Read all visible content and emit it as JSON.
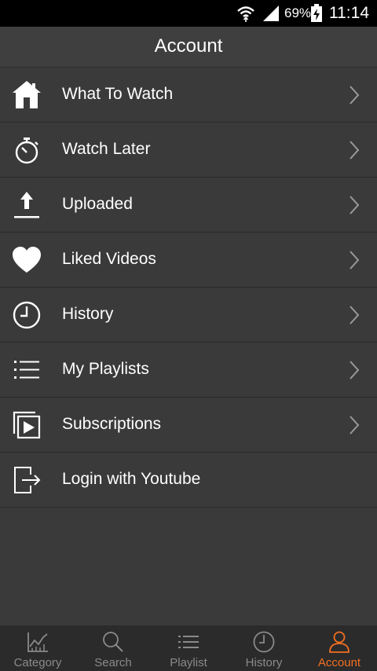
{
  "status_bar": {
    "battery_percent": "69%",
    "time": "11:14"
  },
  "header": {
    "title": "Account"
  },
  "menu": {
    "items": [
      {
        "label": "What To Watch",
        "icon": "home-icon"
      },
      {
        "label": "Watch Later",
        "icon": "stopwatch-icon"
      },
      {
        "label": "Uploaded",
        "icon": "upload-icon"
      },
      {
        "label": "Liked Videos",
        "icon": "heart-icon"
      },
      {
        "label": "History",
        "icon": "clock-icon"
      },
      {
        "label": "My Playlists",
        "icon": "list-icon"
      },
      {
        "label": "Subscriptions",
        "icon": "subscriptions-icon"
      },
      {
        "label": "Login with Youtube",
        "icon": "login-icon"
      }
    ]
  },
  "bottom_nav": {
    "items": [
      {
        "label": "Category",
        "icon": "chart-icon"
      },
      {
        "label": "Search",
        "icon": "search-icon"
      },
      {
        "label": "Playlist",
        "icon": "list-icon"
      },
      {
        "label": "History",
        "icon": "clock-icon"
      },
      {
        "label": "Account",
        "icon": "person-icon"
      }
    ],
    "active": "Account"
  },
  "colors": {
    "accent": "#f36f21",
    "background": "#3a3a3a",
    "nav_inactive": "#8a8a8a"
  }
}
